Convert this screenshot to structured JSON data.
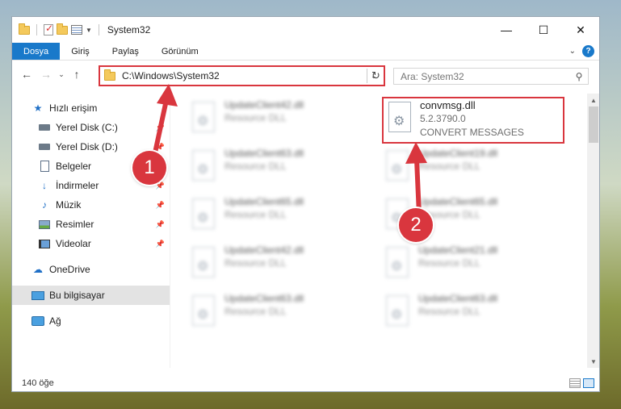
{
  "window": {
    "title": "System32",
    "controls": {
      "minimize": "—",
      "maximize": "☐",
      "close": "✕"
    }
  },
  "ribbon": {
    "tabs": [
      {
        "label": "Dosya"
      },
      {
        "label": "Giriş"
      },
      {
        "label": "Paylaş"
      },
      {
        "label": "Görünüm"
      }
    ],
    "help": "?"
  },
  "address": {
    "path": "C:\\Windows\\System32",
    "search_placeholder": "Ara: System32"
  },
  "nav": {
    "items": [
      {
        "label": "Hızlı erişim"
      },
      {
        "label": "Yerel Disk (C:)"
      },
      {
        "label": "Yerel Disk (D:)"
      },
      {
        "label": "Belgeler"
      },
      {
        "label": "İndirmeler"
      },
      {
        "label": "Müzik"
      },
      {
        "label": "Resimler"
      },
      {
        "label": "Videolar"
      },
      {
        "label": "OneDrive"
      },
      {
        "label": "Bu bilgisayar"
      },
      {
        "label": "Ağ"
      }
    ]
  },
  "files": {
    "left": [
      {
        "name": "UpdateClient42.dll",
        "type": "Resource DLL"
      },
      {
        "name": "UpdateClient63.dll",
        "type": "Resource DLL"
      },
      {
        "name": "UpdateClient65.dll",
        "type": "Resource DLL"
      },
      {
        "name": "UpdateClient42.dll",
        "type": "Resource DLL"
      },
      {
        "name": "UpdateClient63.dll",
        "type": "Resource DLL"
      }
    ],
    "right": [
      {
        "name": "UpdateClient19.dll",
        "type": "Resource DLL"
      },
      {
        "name": "UpdateClient65.dll",
        "type": "Resource DLL"
      },
      {
        "name": "UpdateClient21.dll",
        "type": "Resource DLL"
      },
      {
        "name": "UpdateClient63.dll",
        "type": "Resource DLL"
      }
    ],
    "highlighted": {
      "name": "convmsg.dll",
      "version": "5.2.3790.0",
      "description": "CONVERT MESSAGES"
    }
  },
  "status": {
    "count": "140 öğe"
  },
  "annotations": {
    "step1": "1",
    "step2": "2",
    "color": "#d9363e"
  }
}
